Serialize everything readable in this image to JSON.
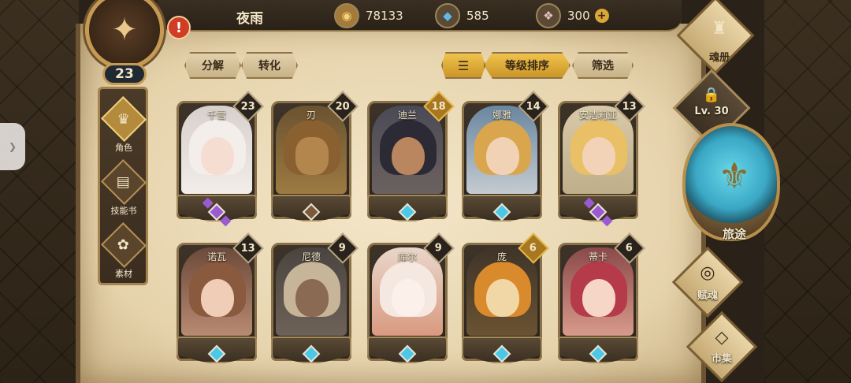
{
  "player": {
    "name": "夜雨",
    "level": "23",
    "alert": "!"
  },
  "resources": {
    "gold": {
      "icon": "gold-coin-icon",
      "value": "78133"
    },
    "gem": {
      "icon": "blue-crystal-icon",
      "value": "585"
    },
    "crystal": {
      "icon": "pink-crystal-icon",
      "value": "300",
      "plus": "+"
    }
  },
  "left_nav": [
    {
      "label": "角色",
      "icon": "character-icon",
      "active": true
    },
    {
      "label": "技能书",
      "icon": "skillbook-icon",
      "active": false
    },
    {
      "label": "素材",
      "icon": "material-icon",
      "active": false
    }
  ],
  "toolbar": {
    "decompose": "分解",
    "convert": "转化",
    "sort_icon": "sort-icon",
    "level_sort": "等级排序",
    "filter": "筛选"
  },
  "heroes": [
    {
      "name": "千雪",
      "level": "23",
      "gem": "purple"
    },
    {
      "name": "刃",
      "level": "20",
      "gem": "purple"
    },
    {
      "name": "迪兰",
      "level": "18",
      "gem": "cyan"
    },
    {
      "name": "娜雅",
      "level": "14",
      "gem": "cyan"
    },
    {
      "name": "安洁莉亚",
      "level": "13",
      "gem": "purple"
    },
    {
      "name": "诺瓦",
      "level": "13",
      "gem": "cyan"
    },
    {
      "name": "尼德",
      "level": "9",
      "gem": "cyan"
    },
    {
      "name": "库尔",
      "level": "9",
      "gem": "cyan"
    },
    {
      "name": "庞",
      "level": "6",
      "gem": "cyan"
    },
    {
      "name": "蒂卡",
      "level": "6",
      "gem": "cyan"
    }
  ],
  "right_panel": {
    "soul_book": "魂册",
    "locked_level": "Lv. 30",
    "journey": "旅途",
    "talent": "赋魂",
    "market": "市集"
  },
  "colors": {
    "accent_gold": "#e8b84a",
    "gem_purple": "#9a5ad1",
    "gem_cyan": "#49c8e8"
  }
}
